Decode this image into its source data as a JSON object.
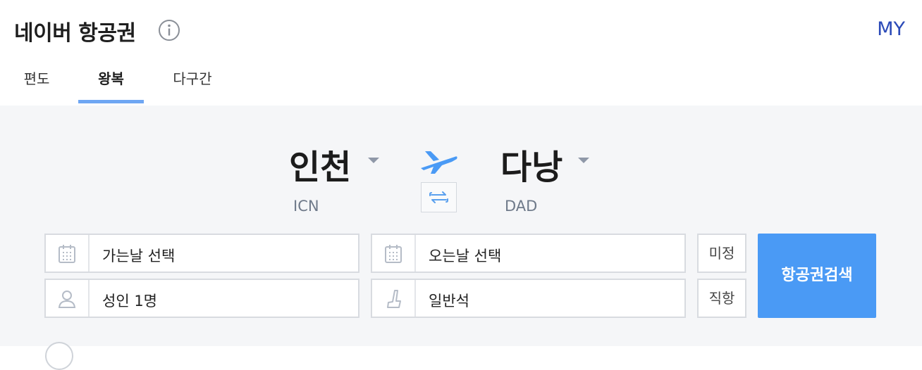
{
  "header": {
    "title": "네이버 항공권",
    "my_label": "MY"
  },
  "tabs": [
    {
      "label": "편도",
      "active": false
    },
    {
      "label": "왕복",
      "active": true
    },
    {
      "label": "다구간",
      "active": false
    }
  ],
  "route": {
    "origin": {
      "city": "인천",
      "code": "ICN"
    },
    "destination": {
      "city": "다낭",
      "code": "DAD"
    }
  },
  "fields": {
    "depart_date": "가는날 선택",
    "return_date": "오는날 선택",
    "undecided": "미정",
    "passengers": "성인 1명",
    "seat_class": "일반석",
    "direct": "직항"
  },
  "search_button": "항공권검색",
  "colors": {
    "accent": "#4a9af5",
    "tab_underline": "#6ea6f3",
    "my_link": "#2b4ab8",
    "body_bg": "#f5f6f8"
  },
  "icons": [
    "info-icon",
    "plane-icon",
    "swap-icon",
    "calendar-icon",
    "person-icon",
    "seat-icon"
  ]
}
